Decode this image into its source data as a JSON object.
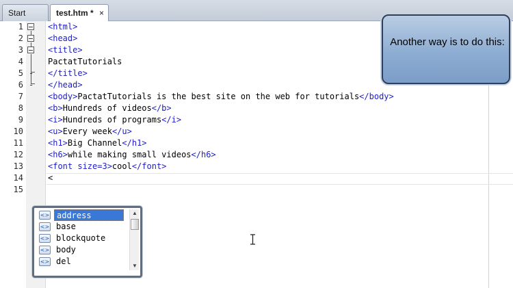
{
  "tabs": [
    {
      "label": "Start Page",
      "active": false
    },
    {
      "label": "test.htm *",
      "active": true,
      "close": "×"
    }
  ],
  "line_numbers": [
    "1",
    "2",
    "3",
    "4",
    "5",
    "6",
    "7",
    "8",
    "9",
    "10",
    "11",
    "12",
    "13",
    "14",
    "15"
  ],
  "fold_markers": [
    "-",
    "-"
  ],
  "code_lines": [
    [
      {
        "t": "tag",
        "v": "<html>"
      }
    ],
    [
      {
        "t": "tag",
        "v": "<head>"
      }
    ],
    [
      {
        "t": "tag",
        "v": "<title>"
      }
    ],
    [
      {
        "t": "txt",
        "v": "PactatTutorials"
      }
    ],
    [
      {
        "t": "tag",
        "v": "</title>"
      }
    ],
    [
      {
        "t": "tag",
        "v": "</head>"
      }
    ],
    [
      {
        "t": "tag",
        "v": "<body>"
      },
      {
        "t": "txt",
        "v": "PactatTutorials is the best site on the web for tutorials"
      },
      {
        "t": "tag",
        "v": "</body>"
      }
    ],
    [
      {
        "t": "tag",
        "v": "<b>"
      },
      {
        "t": "txt",
        "v": "Hundreds of videos"
      },
      {
        "t": "tag",
        "v": "</b>"
      }
    ],
    [
      {
        "t": "tag",
        "v": "<i>"
      },
      {
        "t": "txt",
        "v": "Hundreds of programs"
      },
      {
        "t": "tag",
        "v": "</i>"
      }
    ],
    [
      {
        "t": "tag",
        "v": "<u>"
      },
      {
        "t": "txt",
        "v": "Every week"
      },
      {
        "t": "tag",
        "v": "</u>"
      }
    ],
    [
      {
        "t": "tag",
        "v": "<h1>"
      },
      {
        "t": "txt",
        "v": "Big Channel"
      },
      {
        "t": "tag",
        "v": "</h1>"
      }
    ],
    [
      {
        "t": "tag",
        "v": "<h6>"
      },
      {
        "t": "txt",
        "v": "while making small videos"
      },
      {
        "t": "tag",
        "v": "</h6>"
      }
    ],
    [
      {
        "t": "tag",
        "v": "<font size=3>"
      },
      {
        "t": "txt",
        "v": "cool"
      },
      {
        "t": "tag",
        "v": "</font>"
      }
    ],
    [
      {
        "t": "txt",
        "v": "<"
      }
    ],
    []
  ],
  "autocomplete": {
    "items": [
      "address",
      "base",
      "blockquote",
      "body",
      "del"
    ],
    "selected": "address",
    "item_icon": "tag-icon",
    "icon_glyph": "<>",
    "scroll_up": "▲",
    "scroll_down": "▼"
  },
  "callout": {
    "text": "Another way is to do this:"
  },
  "colors": {
    "tag": "#1c1cc8",
    "selection": "#3a78d8",
    "callout": "#8eadd2"
  }
}
